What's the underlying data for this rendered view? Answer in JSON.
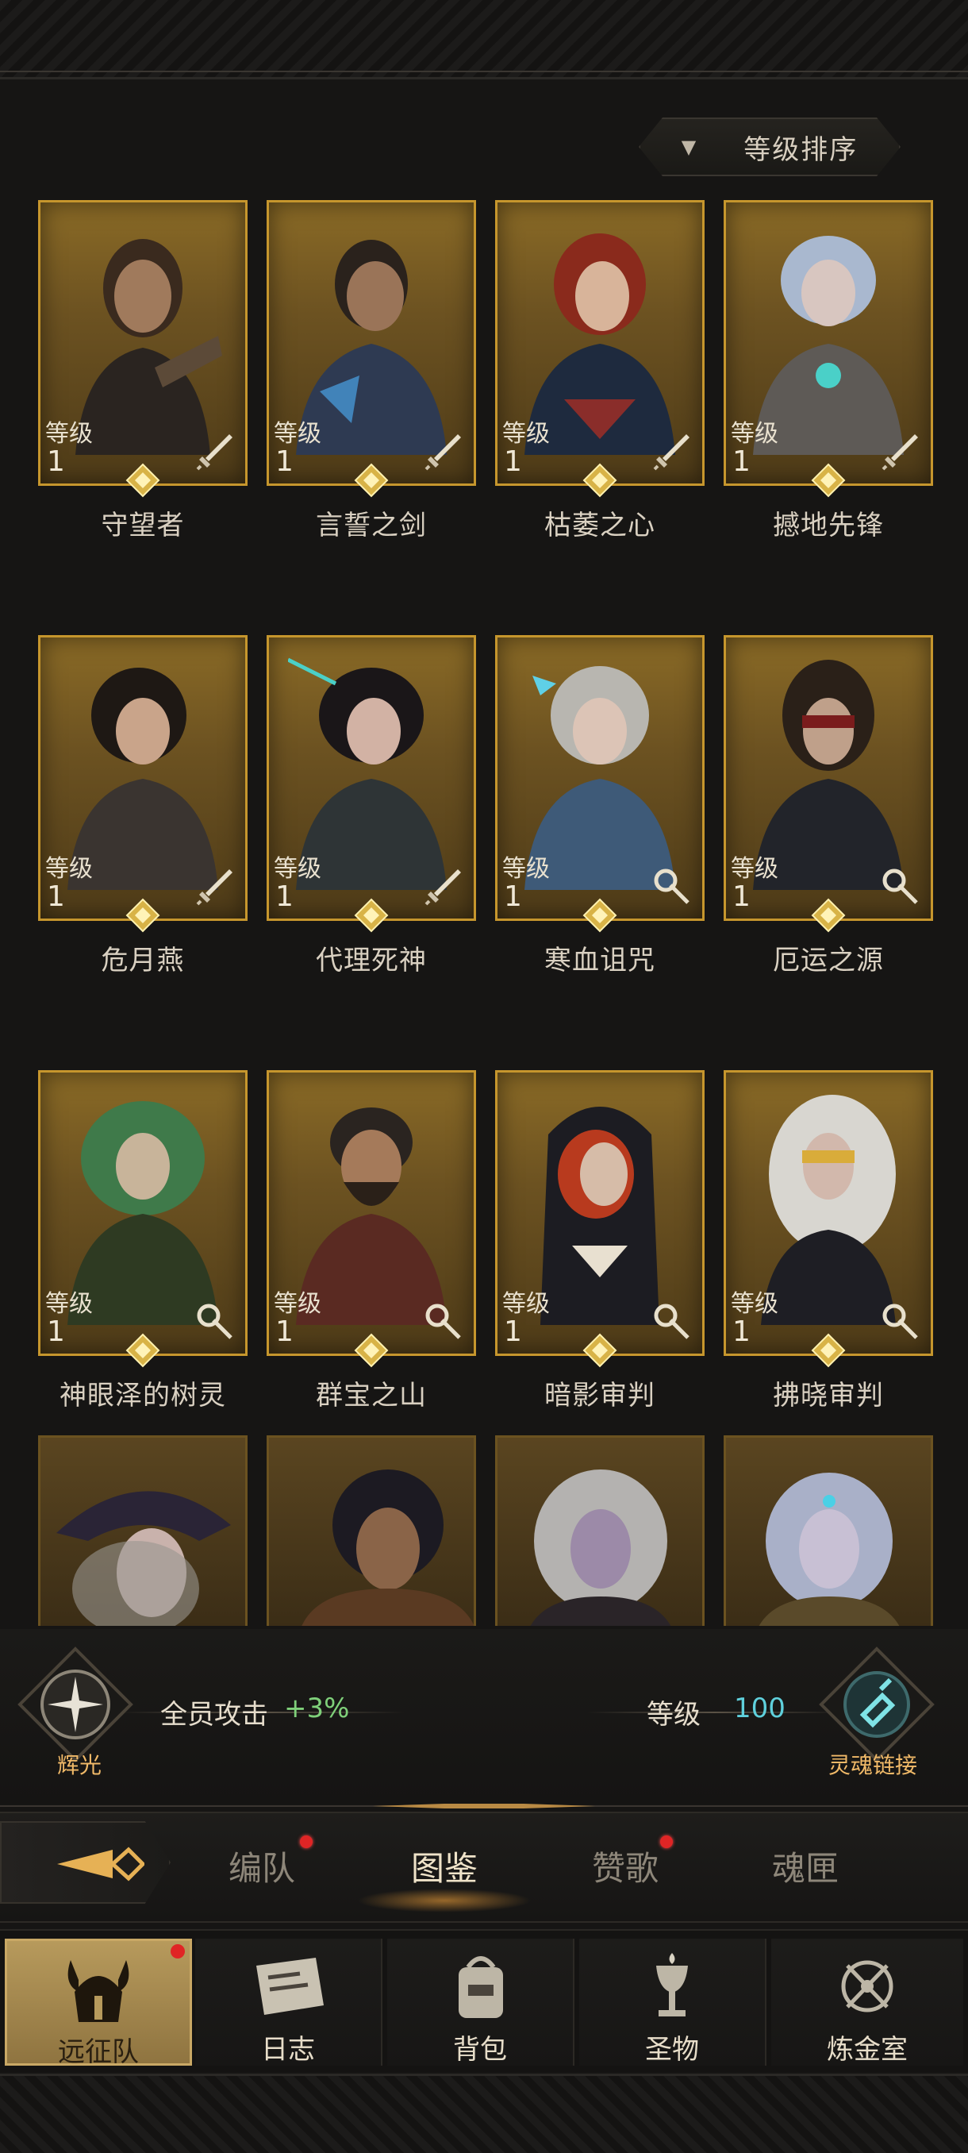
{
  "sort": {
    "label": "等级排序",
    "arrow": "▼"
  },
  "level_label": "等级",
  "heroes": [
    {
      "name": "守望者",
      "level": "1",
      "class_icon": "sword-icon"
    },
    {
      "name": "言誓之剑",
      "level": "1",
      "class_icon": "sword-icon"
    },
    {
      "name": "枯萎之心",
      "level": "1",
      "class_icon": "sword-icon"
    },
    {
      "name": "撼地先锋",
      "level": "1",
      "class_icon": "sword-icon"
    },
    {
      "name": "危月燕",
      "level": "1",
      "class_icon": "sword-icon"
    },
    {
      "name": "代理死神",
      "level": "1",
      "class_icon": "sword-icon"
    },
    {
      "name": "寒血诅咒",
      "level": "1",
      "class_icon": "staff-icon"
    },
    {
      "name": "厄运之源",
      "level": "1",
      "class_icon": "staff-icon"
    },
    {
      "name": "神眼泽的树灵",
      "level": "1",
      "class_icon": "staff-icon"
    },
    {
      "name": "群宝之山",
      "level": "1",
      "class_icon": "staff-icon"
    },
    {
      "name": "暗影审判",
      "level": "1",
      "class_icon": "staff-icon"
    },
    {
      "name": "拂晓审判",
      "level": "1",
      "class_icon": "staff-icon"
    }
  ],
  "stats": {
    "radiance_label": "辉光",
    "team_attack_label": "全员攻击",
    "team_attack_value": "+3%",
    "level_label": "等级",
    "level_value": "100",
    "soul_link_label": "灵魂链接"
  },
  "tabs": [
    {
      "label": "编队",
      "dot": true
    },
    {
      "label": "图鉴",
      "dot": false,
      "active": true
    },
    {
      "label": "赞歌",
      "dot": true
    },
    {
      "label": "魂匣",
      "dot": false
    }
  ],
  "nav": [
    {
      "label": "远征队",
      "icon": "helmet-icon",
      "active": true,
      "dot": true
    },
    {
      "label": "日志",
      "icon": "scroll-icon"
    },
    {
      "label": "背包",
      "icon": "bag-icon"
    },
    {
      "label": "圣物",
      "icon": "chalice-icon"
    },
    {
      "label": "炼金室",
      "icon": "alchemy-icon"
    }
  ],
  "colors": {
    "gold": "#c6962d",
    "green": "#7fd07a",
    "cyan": "#5fd0dc",
    "badge": "#f0b968"
  }
}
